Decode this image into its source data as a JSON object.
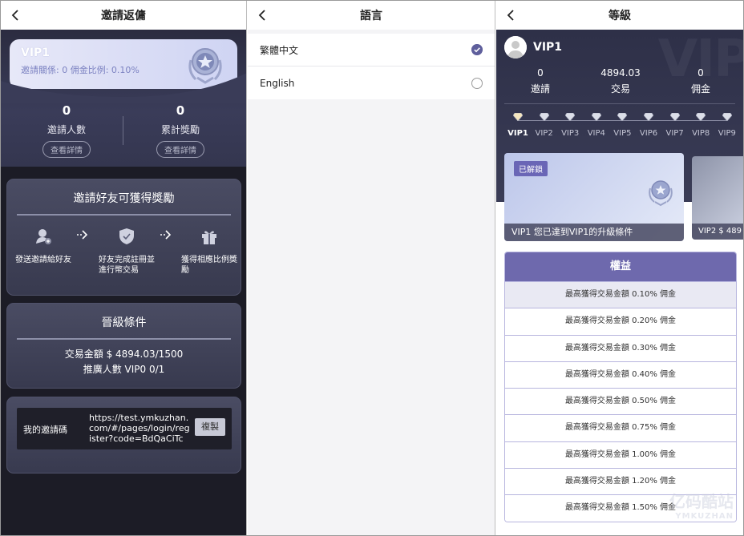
{
  "invite_screen": {
    "title": "邀請返傭",
    "vip_card": {
      "level": "VIP1",
      "summary": "邀請關係: 0 佣金比例: 0.10%"
    },
    "stats": [
      {
        "value": "0",
        "label": "邀請人數",
        "button": "查看詳情"
      },
      {
        "value": "0",
        "label": "累計獎勵",
        "button": "查看詳情"
      }
    ],
    "how_card": {
      "title": "邀請好友可獲得獎勵",
      "steps": [
        "發送邀請給好友",
        "好友完成註冊並進行幣交易",
        "獲得相應比例獎勵"
      ]
    },
    "upgrade_card": {
      "title": "晉級條件",
      "conditions": [
        "交易金額 $ 4894.03/1500",
        "推廣人數 VIP0 0/1"
      ]
    },
    "invite_code": {
      "label": "我的邀請碼",
      "url": "https://test.ymkuzhan.com/#/pages/login/register?code=BdQaCiTc",
      "copy_button": "複製"
    }
  },
  "language_screen": {
    "title": "語言",
    "options": [
      {
        "label": "繁體中文",
        "selected": true
      },
      {
        "label": "English",
        "selected": false
      }
    ]
  },
  "level_screen": {
    "title": "等級",
    "user_level": "VIP1",
    "watermark": "VIP",
    "stats": [
      {
        "value": "0",
        "label": "邀請"
      },
      {
        "value": "4894.03",
        "label": "交易"
      },
      {
        "value": "0",
        "label": "佣金"
      }
    ],
    "levels": [
      "VIP1",
      "VIP2",
      "VIP3",
      "VIP4",
      "VIP5",
      "VIP6",
      "VIP7",
      "VIP8",
      "VIP9"
    ],
    "current_level_index": 0,
    "level_card": {
      "badge": "已解鎖",
      "caption": "VIP1 您已達到VIP1的升級條件"
    },
    "next_card": {
      "caption": "VIP2 $ 489"
    },
    "rights": {
      "title": "權益",
      "rows": [
        "最高獲得交易金額 0.10% 佣金",
        "最高獲得交易金額 0.20% 佣金",
        "最高獲得交易金額 0.30% 佣金",
        "最高獲得交易金額 0.40% 佣金",
        "最高獲得交易金額 0.50% 佣金",
        "最高獲得交易金額 0.75% 佣金",
        "最高獲得交易金額 1.00% 佣金",
        "最高獲得交易金額 1.20% 佣金",
        "最高獲得交易金額 1.50% 佣金"
      ]
    },
    "brand_watermark": {
      "cn": "亿码酷站",
      "en": "YMKUZHAN"
    }
  },
  "colors": {
    "accent": "#6e69ad",
    "dark_bg": "#2e3048",
    "radio_on": "#5f5f9c"
  }
}
